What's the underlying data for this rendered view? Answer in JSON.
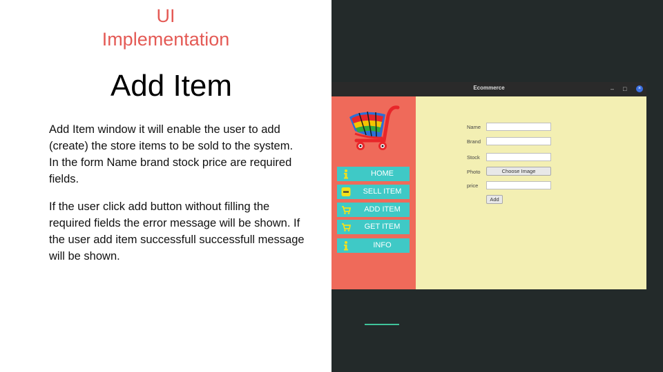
{
  "slide": {
    "subtitle_line1": "UI",
    "subtitle_line2": "Implementation",
    "title": "Add Item",
    "paragraph1": "Add Item window it will enable the user to add (create) the store items to be sold to the system. In the form Name brand stock price are required fields.",
    "paragraph2": "If the user click add button without filling the required fields the error message will be shown. If the user add item successfull successfull message will be shown."
  },
  "window": {
    "title": "Ecommerce",
    "minimize": "–",
    "maximize": "□",
    "close": "×"
  },
  "sidebar": {
    "logo_icon": "shopping-cart-icon",
    "items": [
      {
        "label": "HOME",
        "icon": "info-icon"
      },
      {
        "label": "SELL ITEM",
        "icon": "minus-icon"
      },
      {
        "label": "ADD ITEM",
        "icon": "cart-icon"
      },
      {
        "label": "GET ITEM",
        "icon": "cart-icon"
      },
      {
        "label": "INFO",
        "icon": "info-icon"
      }
    ]
  },
  "form": {
    "name_label": "Name",
    "name_value": "",
    "brand_label": "Brand",
    "brand_value": "",
    "stock_label": "Stock",
    "stock_value": "",
    "photo_label": "Photo",
    "choose_image_label": "Choose Image",
    "price_label": "price",
    "price_value": "",
    "add_label": "Add"
  },
  "colors": {
    "sidebar_bg": "#ef6a5a",
    "content_bg": "#f3efb3",
    "nav_button": "#3fc9c6",
    "accent_red": "#e45a55",
    "right_panel_bg": "#232a2a"
  }
}
